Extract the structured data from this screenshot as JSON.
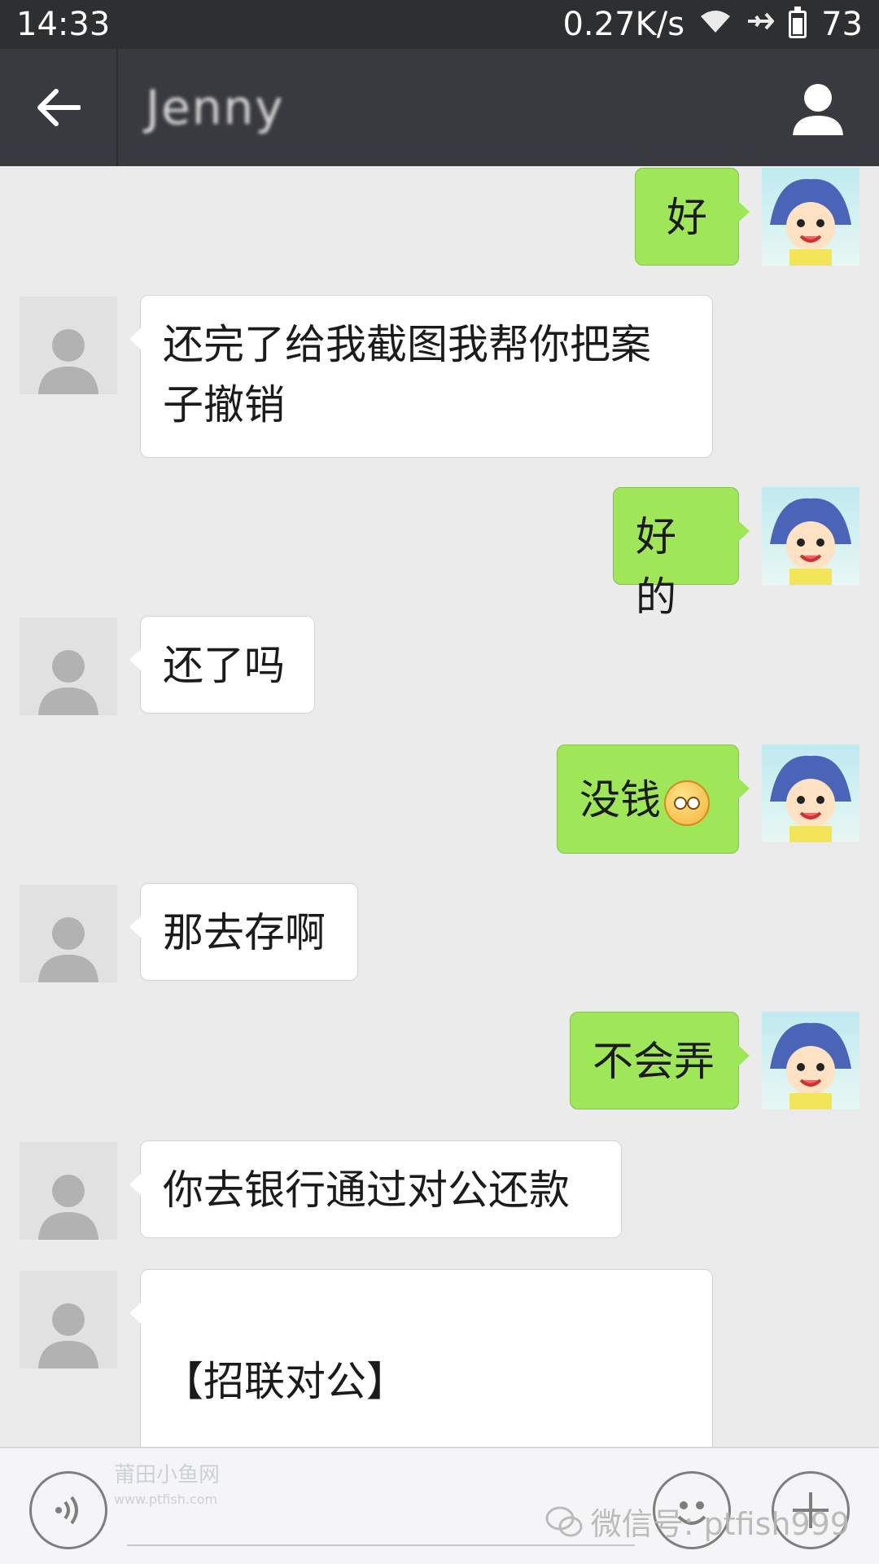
{
  "status_bar": {
    "time": "14:33",
    "network_speed": "0.27K/s",
    "battery": "73",
    "icons": [
      "wifi-icon",
      "airplane-icon",
      "battery-icon"
    ]
  },
  "header": {
    "back_icon": "back-arrow-icon",
    "contact_name": "Jenny",
    "profile_icon": "contact-profile-icon"
  },
  "messages": [
    {
      "sender": "me",
      "text": "好"
    },
    {
      "sender": "them",
      "text": "还完了给我截图我帮你把案子撤销"
    },
    {
      "sender": "me",
      "text": "好的"
    },
    {
      "sender": "them",
      "text": "还了吗"
    },
    {
      "sender": "me",
      "text": "没钱",
      "emoji": "worried-face-emoji"
    },
    {
      "sender": "them",
      "text": "那去存啊"
    },
    {
      "sender": "me",
      "text": "不会弄"
    },
    {
      "sender": "them",
      "text": "你去银行通过对公还款"
    },
    {
      "sender": "them",
      "text": "【招联对公】"
    }
  ],
  "input_bar": {
    "voice_icon": "voice-input-icon",
    "emoji_icon": "emoji-icon",
    "plus_icon": "plus-icon"
  },
  "watermark": {
    "left_text": "莆田小鱼网",
    "left_url": "www.ptfish.com",
    "right_text": "微信号: ptfish999"
  },
  "colors": {
    "status_bar": "#2e2f31",
    "title_bar": "#393a3f",
    "chat_background": "#ebebeb",
    "my_bubble": "#9fe658",
    "their_bubble": "#ffffff"
  }
}
